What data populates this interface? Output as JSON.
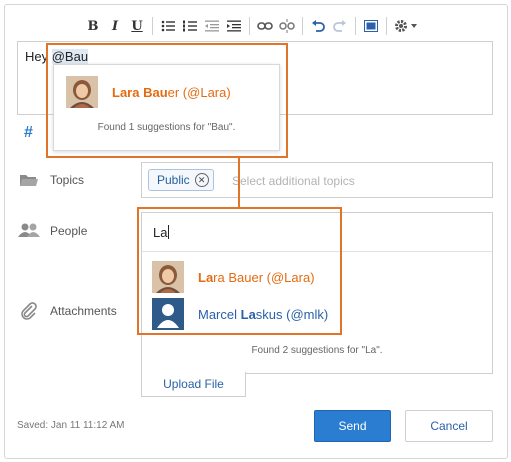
{
  "toolbar": {
    "bold_label": "B",
    "italic_label": "I",
    "underline_label": "U",
    "icons": [
      "bulleted-list-icon",
      "numbered-list-icon",
      "outdent-icon",
      "indent-icon",
      "link-icon",
      "unlink-icon",
      "undo-icon",
      "redo-icon",
      "source-icon",
      "settings-icon"
    ]
  },
  "editor": {
    "text_prefix": "Hey ",
    "mention_text": "@Bau"
  },
  "mention_popup": {
    "suggestion": {
      "match": "Lara Bau",
      "rest": "er (@Lara)"
    },
    "found_text": "Found 1 suggestions for \"Bau\"."
  },
  "hashtag": "#",
  "topics": {
    "label": "Topics",
    "chip": "Public",
    "placeholder": "Select additional topics"
  },
  "people": {
    "label": "People",
    "input_value": "La",
    "suggestions": [
      {
        "match": "La",
        "rest": "ra Bauer (@Lara)"
      },
      {
        "prefix": "Marcel ",
        "match": "La",
        "rest": "skus (@mlk)"
      }
    ],
    "found_text": "Found 2 suggestions for \"La\"."
  },
  "attachments": {
    "label": "Attachments",
    "upload_label": "Upload File"
  },
  "footer": {
    "saved_text": "Saved: Jan 11 11:12 AM",
    "send_label": "Send",
    "cancel_label": "Cancel"
  },
  "colors": {
    "accent": "#2a7dd1",
    "highlight": "#e2742a",
    "link": "#2a61a8"
  }
}
